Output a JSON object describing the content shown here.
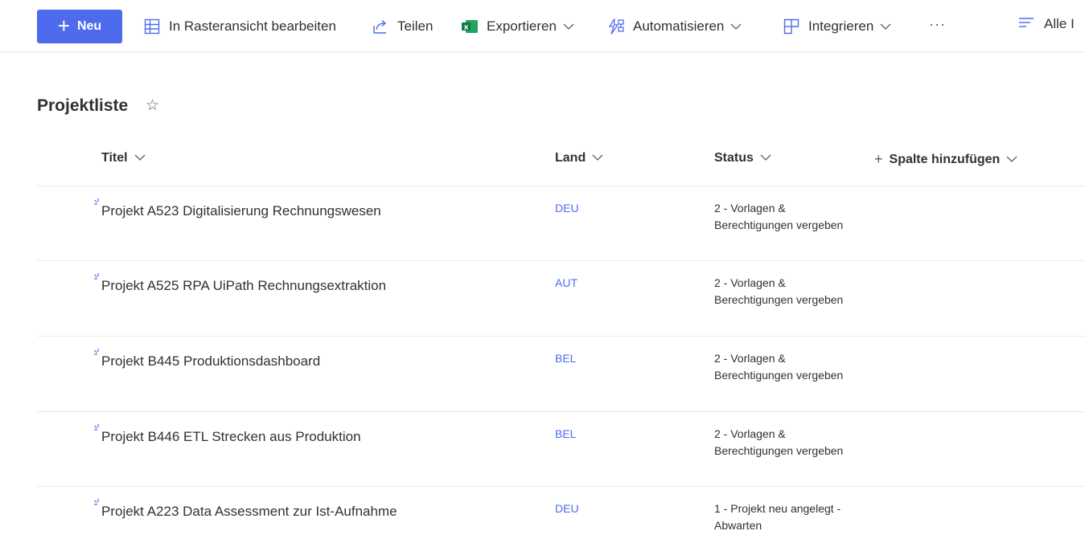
{
  "toolbar": {
    "new_label": "Neu",
    "grid_label": "In Rasteransicht bearbeiten",
    "share_label": "Teilen",
    "export_label": "Exportieren",
    "automate_label": "Automatisieren",
    "integrate_label": "Integrieren",
    "more_label": "···",
    "view_label": "Alle I"
  },
  "list": {
    "title": "Projektliste",
    "star": "☆",
    "columns": {
      "title": "Titel",
      "land": "Land",
      "status": "Status",
      "add": "Spalte hinzufügen",
      "add_plus": "+"
    },
    "rows": [
      {
        "title": "Projekt A523 Digitalisierung Rechnungswesen",
        "land": "DEU",
        "status": "2 - Vorlagen & Berechtigungen vergeben"
      },
      {
        "title": "Projekt A525 RPA UiPath Rechnungsextraktion",
        "land": "AUT",
        "status": "2 - Vorlagen & Berechtigungen vergeben"
      },
      {
        "title": "Projekt B445 Produktionsdashboard",
        "land": "BEL",
        "status": "2 - Vorlagen & Berechtigungen vergeben"
      },
      {
        "title": "Projekt B446 ETL Strecken aus Produktion",
        "land": "BEL",
        "status": "2 - Vorlagen & Berechtigungen vergeben"
      },
      {
        "title": "Projekt A223 Data Assessment zur Ist-Aufnahme",
        "land": "DEU",
        "status": "1 - Projekt neu angelegt - Abwarten"
      }
    ]
  },
  "colors": {
    "accent": "#4f6bed",
    "excel": "#107c41",
    "text": "#323130",
    "divider": "#edebe9"
  },
  "icons": [
    "plus-icon",
    "grid-icon",
    "share-icon",
    "excel-icon",
    "automate-icon",
    "integrate-icon",
    "chevron-down-icon",
    "more-icon",
    "view-icon",
    "star-icon",
    "new-item-sparkle-icon"
  ]
}
